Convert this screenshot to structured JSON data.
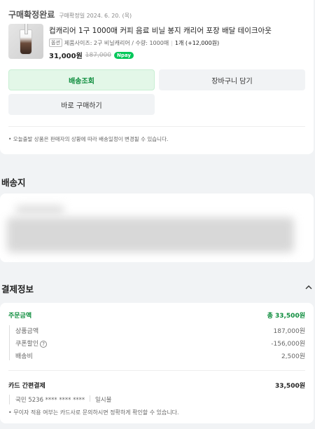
{
  "order": {
    "status": "구매확정완료",
    "confirm_date": "구매확정일 2024. 6. 20. (목)",
    "product_title": "컵캐리어 1구 1000매 커피 음료 비닐 봉지 캐리어 포장 배달 테이크아웃",
    "option_badge": "옵션",
    "option_text": "제품사이즈: 2구 비닐캐리어 / 수량: 1000매",
    "qty_text": "1개 (+12,000원)",
    "price": "31,000원",
    "original_price": "187,000",
    "npay_label": "pay",
    "track_button": "배송조회",
    "cart_button": "장바구니 담기",
    "buy_button": "바로 구매하기",
    "notice": "• 오늘출발 상품은 판매자의 상황에 따라 배송일정이 변경될 수 있습니다."
  },
  "shipping": {
    "title": "배송지"
  },
  "payment": {
    "title": "결제정보",
    "order_amount_label": "주문금액",
    "order_amount_value": "총 33,500원",
    "items": [
      {
        "label": "상품금액",
        "value": "187,000원"
      },
      {
        "label": "쿠폰할인",
        "value": "-156,000원"
      },
      {
        "label": "배송비",
        "value": "2,500원"
      }
    ],
    "method_label": "카드 간편결제",
    "method_value": "33,500원",
    "card_info": "국민 5236 **** **** ****",
    "installment": "일시불",
    "note": "• 무이자 적용 여부는 카드사로 문의하시면 정확하게 확인할 수 있습니다."
  },
  "colors": {
    "accent": "#03c75a",
    "accent_text": "#0c8c3c"
  }
}
